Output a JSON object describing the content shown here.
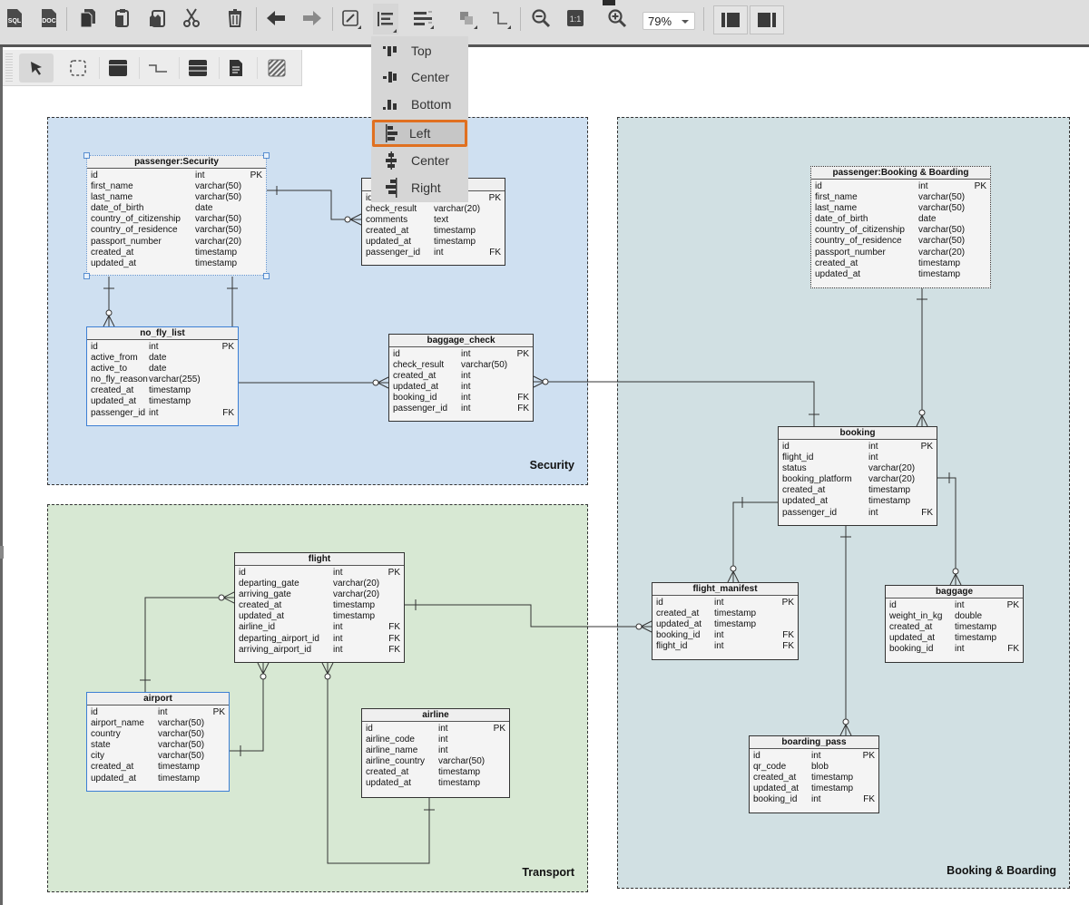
{
  "toolbar": {
    "buttons": [
      {
        "name": "sql-export-button",
        "label": "SQL"
      },
      {
        "name": "doc-export-button",
        "label": "DOC"
      },
      {
        "name": "copy-button"
      },
      {
        "name": "paste-button"
      },
      {
        "name": "duplicate-button"
      },
      {
        "name": "cut-button"
      },
      {
        "name": "delete-button"
      },
      {
        "name": "undo-button"
      },
      {
        "name": "redo-button"
      },
      {
        "name": "edit-style-button"
      },
      {
        "name": "align-button"
      },
      {
        "name": "distribute-button"
      },
      {
        "name": "arrange-button"
      },
      {
        "name": "connector-style-button"
      },
      {
        "name": "zoom-out-button"
      },
      {
        "name": "actual-size-button",
        "label": "1:1"
      },
      {
        "name": "zoom-in-button"
      }
    ],
    "zoom_value": "79%",
    "panel_buttons": [
      "toggle-left-panel",
      "toggle-right-panel"
    ]
  },
  "toolbox": {
    "tools": [
      "pointer",
      "selection",
      "table",
      "connector",
      "list",
      "note",
      "hatch-area"
    ],
    "active_tool": "pointer"
  },
  "align_menu": {
    "items": [
      {
        "label": "Top",
        "icon": "align-top-icon"
      },
      {
        "label": "Center",
        "icon": "align-middle-icon"
      },
      {
        "label": "Bottom",
        "icon": "align-bottom-icon"
      },
      {
        "label": "Left",
        "icon": "align-left-icon",
        "highlighted": true
      },
      {
        "label": "Center",
        "icon": "align-center-icon"
      },
      {
        "label": "Right",
        "icon": "align-right-icon"
      }
    ]
  },
  "colors": {
    "security_zone": "#cfe0f1",
    "transport_zone": "#d7e8d3",
    "booking_zone": "#d1e0e3",
    "highlight": "#e07020",
    "selection": "#3d7fd4"
  },
  "zones": {
    "security": "Security",
    "transport": "Transport",
    "booking": "Booking & Boarding"
  },
  "entities": {
    "passenger_security": {
      "title": "passenger:Security",
      "rows": [
        [
          "id",
          "int",
          "PK"
        ],
        [
          "first_name",
          "varchar(50)",
          ""
        ],
        [
          "last_name",
          "varchar(50)",
          ""
        ],
        [
          "date_of_birth",
          "date",
          ""
        ],
        [
          "country_of_citizenship",
          "varchar(50)",
          ""
        ],
        [
          "country_of_residence",
          "varchar(50)",
          ""
        ],
        [
          "passport_number",
          "varchar(20)",
          ""
        ],
        [
          "created_at",
          "timestamp",
          ""
        ],
        [
          "updated_at",
          "timestamp",
          ""
        ]
      ]
    },
    "security_check": {
      "title": "",
      "rows": [
        [
          "id",
          "",
          "PK"
        ],
        [
          "check_result",
          "varchar(20)",
          ""
        ],
        [
          "comments",
          "text",
          ""
        ],
        [
          "created_at",
          "timestamp",
          ""
        ],
        [
          "updated_at",
          "timestamp",
          ""
        ],
        [
          "passenger_id",
          "int",
          "FK"
        ]
      ]
    },
    "no_fly_list": {
      "title": "no_fly_list",
      "rows": [
        [
          "id",
          "int",
          "PK"
        ],
        [
          "active_from",
          "date",
          ""
        ],
        [
          "active_to",
          "date",
          ""
        ],
        [
          "no_fly_reason",
          "varchar(255)",
          ""
        ],
        [
          "created_at",
          "timestamp",
          ""
        ],
        [
          "updated_at",
          "timestamp",
          ""
        ],
        [
          "passenger_id",
          "int",
          "FK"
        ]
      ]
    },
    "baggage_check": {
      "title": "baggage_check",
      "rows": [
        [
          "id",
          "int",
          "PK"
        ],
        [
          "check_result",
          "varchar(50)",
          ""
        ],
        [
          "created_at",
          "int",
          ""
        ],
        [
          "updated_at",
          "int",
          ""
        ],
        [
          "booking_id",
          "int",
          "FK"
        ],
        [
          "passenger_id",
          "int",
          "FK"
        ]
      ]
    },
    "passenger_booking": {
      "title": "passenger:Booking & Boarding",
      "rows": [
        [
          "id",
          "int",
          "PK"
        ],
        [
          "first_name",
          "varchar(50)",
          ""
        ],
        [
          "last_name",
          "varchar(50)",
          ""
        ],
        [
          "date_of_birth",
          "date",
          ""
        ],
        [
          "country_of_citizenship",
          "varchar(50)",
          ""
        ],
        [
          "country_of_residence",
          "varchar(50)",
          ""
        ],
        [
          "passport_number",
          "varchar(20)",
          ""
        ],
        [
          "created_at",
          "timestamp",
          ""
        ],
        [
          "updated_at",
          "timestamp",
          ""
        ]
      ]
    },
    "booking": {
      "title": "booking",
      "rows": [
        [
          "id",
          "int",
          "PK"
        ],
        [
          "flight_id",
          "int",
          ""
        ],
        [
          "status",
          "varchar(20)",
          ""
        ],
        [
          "booking_platform",
          "varchar(20)",
          ""
        ],
        [
          "created_at",
          "timestamp",
          ""
        ],
        [
          "updated_at",
          "timestamp",
          ""
        ],
        [
          "passenger_id",
          "int",
          "FK"
        ]
      ]
    },
    "flight_manifest": {
      "title": "flight_manifest",
      "rows": [
        [
          "id",
          "int",
          "PK"
        ],
        [
          "created_at",
          "timestamp",
          ""
        ],
        [
          "updated_at",
          "timestamp",
          ""
        ],
        [
          "booking_id",
          "int",
          "FK"
        ],
        [
          "flight_id",
          "int",
          "FK"
        ]
      ]
    },
    "baggage": {
      "title": "baggage",
      "rows": [
        [
          "id",
          "int",
          "PK"
        ],
        [
          "weight_in_kg",
          "double",
          ""
        ],
        [
          "created_at",
          "timestamp",
          ""
        ],
        [
          "updated_at",
          "timestamp",
          ""
        ],
        [
          "booking_id",
          "int",
          "FK"
        ]
      ]
    },
    "boarding_pass": {
      "title": "boarding_pass",
      "rows": [
        [
          "id",
          "int",
          "PK"
        ],
        [
          "qr_code",
          "blob",
          ""
        ],
        [
          "created_at",
          "timestamp",
          ""
        ],
        [
          "updated_at",
          "timestamp",
          ""
        ],
        [
          "booking_id",
          "int",
          "FK"
        ]
      ]
    },
    "flight": {
      "title": "flight",
      "rows": [
        [
          "id",
          "int",
          "PK"
        ],
        [
          "departing_gate",
          "varchar(20)",
          ""
        ],
        [
          "arriving_gate",
          "varchar(20)",
          ""
        ],
        [
          "created_at",
          "timestamp",
          ""
        ],
        [
          "updated_at",
          "timestamp",
          ""
        ],
        [
          "airline_id",
          "int",
          "FK"
        ],
        [
          "departing_airport_id",
          "int",
          "FK"
        ],
        [
          "arriving_airport_id",
          "int",
          "FK"
        ]
      ]
    },
    "airport": {
      "title": "airport",
      "rows": [
        [
          "id",
          "int",
          "PK"
        ],
        [
          "airport_name",
          "varchar(50)",
          ""
        ],
        [
          "country",
          "varchar(50)",
          ""
        ],
        [
          "state",
          "varchar(50)",
          ""
        ],
        [
          "city",
          "varchar(50)",
          ""
        ],
        [
          "created_at",
          "timestamp",
          ""
        ],
        [
          "updated_at",
          "timestamp",
          ""
        ]
      ]
    },
    "airline": {
      "title": "airline",
      "rows": [
        [
          "id",
          "int",
          "PK"
        ],
        [
          "airline_code",
          "int",
          ""
        ],
        [
          "airline_name",
          "int",
          ""
        ],
        [
          "airline_country",
          "varchar(50)",
          ""
        ],
        [
          "created_at",
          "timestamp",
          ""
        ],
        [
          "updated_at",
          "timestamp",
          ""
        ]
      ]
    }
  }
}
